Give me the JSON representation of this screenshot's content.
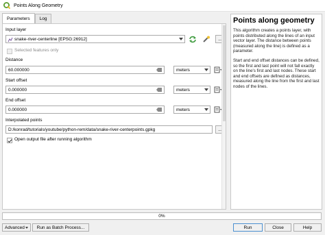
{
  "window": {
    "title": "Points Along Geometry"
  },
  "tabs": [
    {
      "label": "Parameters"
    },
    {
      "label": "Log"
    }
  ],
  "params": {
    "input_layer": {
      "label": "Input layer",
      "value": "snake-river-centerline [EPSG:26912]",
      "more_label": "..."
    },
    "selected_only": {
      "label": "Selected features only",
      "checked": false
    },
    "distance": {
      "label": "Distance",
      "value": "60.000000",
      "unit": "meters"
    },
    "start_offset": {
      "label": "Start offset",
      "value": "0.000000",
      "unit": "meters"
    },
    "end_offset": {
      "label": "End offset",
      "value": "0.000000",
      "unit": "meters"
    },
    "output": {
      "label": "Interpolated points",
      "value": "D:/konrad/tutorials/youtube/python-rem/data/snake-river-centerpoints.gpkg",
      "more_label": "..."
    },
    "open_output": {
      "label": "Open output file after running algorithm",
      "checked": true
    }
  },
  "help": {
    "title": "Points along geometry",
    "p1": "This algorithm creates a points layer, with points distributed along the lines of an input vector layer. The distance between points (measured along the line) is defined as a parameter.",
    "p2": "Start and end offset distances can be defined, so the first and last point will not fall exactly on the line's first and last nodes. These start and end offsets are defined as distances, measured along the line from the first and last nodes of the lines."
  },
  "progress": {
    "value": 0,
    "text": "0%"
  },
  "footer": {
    "advanced": "Advanced",
    "batch": "Run as Batch Process...",
    "run": "Run",
    "close": "Close",
    "help": "Help"
  },
  "colors": {
    "accent": "#4a8fd0",
    "qgis_green": "#5a9e2f"
  },
  "icons": [
    "qgis-icon",
    "line-layer-icon",
    "iterate-icon",
    "edit-wrench-icon",
    "data-defined-icon",
    "clear-icon",
    "dropdown-arrow-icon"
  ]
}
